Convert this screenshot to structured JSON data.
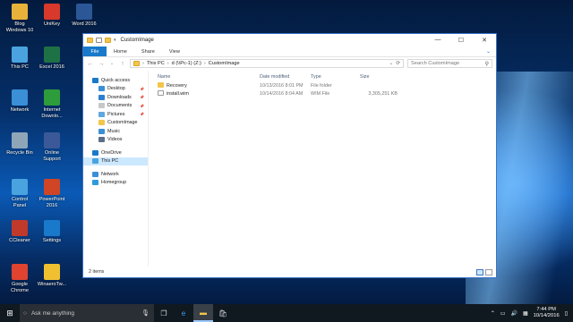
{
  "desktop": {
    "icons": [
      {
        "label": "Blog\nWindows 10",
        "color": "#e8b23a"
      },
      {
        "label": "UniKey",
        "color": "#d8392b"
      },
      {
        "label": "Word 2016",
        "color": "#2b5797"
      },
      {
        "label": "This PC",
        "color": "#4aa3df"
      },
      {
        "label": "Excel 2016",
        "color": "#1e7145"
      },
      {
        "label": "Network",
        "color": "#3a8fd6"
      },
      {
        "label": "Internet\nDownlo...",
        "color": "#2d9c3a"
      },
      {
        "label": "Recycle Bin",
        "color": "#8fa6b8"
      },
      {
        "label": "Online\nSupport",
        "color": "#3b5998"
      },
      {
        "label": "Control\nPanel",
        "color": "#4aa3df"
      },
      {
        "label": "PowerPoint\n2016",
        "color": "#d04525"
      },
      {
        "label": "CCleaner",
        "color": "#c0392b"
      },
      {
        "label": "Settings",
        "color": "#1979ca"
      },
      {
        "label": "Google\nChrome",
        "color": "#e0432f"
      },
      {
        "label": "WinaeroTw...",
        "color": "#f0c030"
      }
    ]
  },
  "window": {
    "title": "CustomImage",
    "controls": {
      "minimize": "—",
      "maximize": "☐",
      "close": "✕"
    },
    "ribbon": {
      "file": "File",
      "tabs": [
        "Home",
        "Share",
        "View"
      ],
      "expand": "⌄"
    },
    "address": {
      "back": "←",
      "forward": "→",
      "up": "↑",
      "recent": "⌄",
      "crumbs": [
        "This PC",
        "d (\\\\Pc-1) (Z:)",
        "CustomImage"
      ],
      "refresh": "⟳"
    },
    "search": {
      "placeholder": "Search CustomImage",
      "icon": "search-icon"
    },
    "nav": [
      {
        "label": "Quick access",
        "kind": "star",
        "sub": false,
        "pin": false
      },
      {
        "label": "Desktop",
        "kind": "desktop",
        "sub": true,
        "pin": true
      },
      {
        "label": "Downloads",
        "kind": "download",
        "sub": true,
        "pin": true
      },
      {
        "label": "Documents",
        "kind": "docs",
        "sub": true,
        "pin": true
      },
      {
        "label": "Pictures",
        "kind": "pics",
        "sub": true,
        "pin": true
      },
      {
        "label": "CustomImage",
        "kind": "folder",
        "sub": true,
        "pin": false
      },
      {
        "label": "Music",
        "kind": "music",
        "sub": true,
        "pin": false
      },
      {
        "label": "Videos",
        "kind": "video",
        "sub": true,
        "pin": false
      },
      {
        "label": "OneDrive",
        "kind": "cloud",
        "sub": false,
        "pin": false
      },
      {
        "label": "This PC",
        "kind": "pc",
        "sub": false,
        "pin": false
      },
      {
        "label": "Network",
        "kind": "net",
        "sub": false,
        "pin": false
      },
      {
        "label": "Homegroup",
        "kind": "home",
        "sub": false,
        "pin": false
      }
    ],
    "columns": {
      "name": "Name",
      "date": "Date modified",
      "type": "Type",
      "size": "Size"
    },
    "files": [
      {
        "name": "Recovery",
        "date": "10/13/2016 8:01 PM",
        "type": "File folder",
        "size": ""
      },
      {
        "name": "install.wim",
        "date": "10/14/2016 8:04 AM",
        "type": "WIM File",
        "size": "3,305,251 KB"
      }
    ],
    "status": "2 items"
  },
  "taskbar": {
    "start_icon": "windows-logo-icon",
    "search_placeholder": "Ask me anything",
    "clock_time": "7:44 PM",
    "clock_date": "10/14/2016"
  }
}
